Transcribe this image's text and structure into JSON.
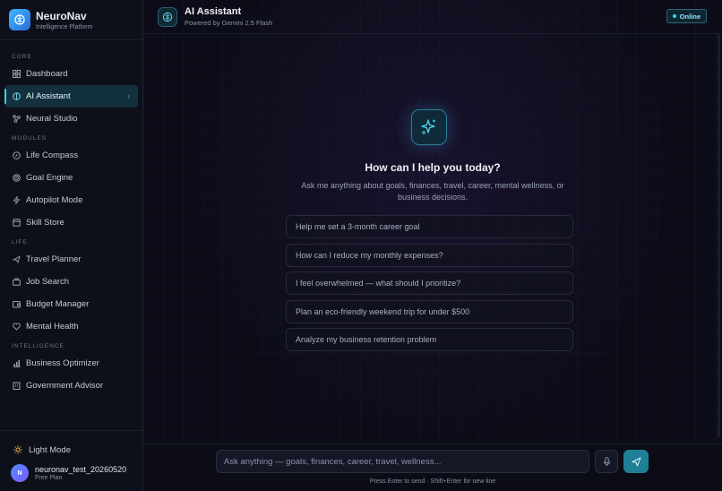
{
  "brand": {
    "name": "NeuroNav",
    "subtitle": "Intelligence Platform"
  },
  "sidebar": {
    "sections": {
      "core": "CORE",
      "modules": "MODULES",
      "life": "LIFE",
      "intelligence": "INTELLIGENCE"
    },
    "items": {
      "dashboard": "Dashboard",
      "ai_assistant": "AI Assistant",
      "neural_studio": "Neural Studio",
      "life_compass": "Life Compass",
      "goal_engine": "Goal Engine",
      "autopilot_mode": "Autopilot Mode",
      "skill_store": "Skill Store",
      "travel_planner": "Travel Planner",
      "job_search": "Job Search",
      "budget_manager": "Budget Manager",
      "mental_health": "Mental Health",
      "business_optimizer": "Business Optimizer",
      "government_advisor": "Government Advisor"
    },
    "active_item": "ai_assistant",
    "light_mode_label": "Light Mode",
    "user": {
      "initial": "N",
      "name": "neuronav_test_20260520",
      "plan": "Free Plan"
    }
  },
  "header": {
    "title": "AI Assistant",
    "subtitle": "Powered by Gemini 2.5 Flash",
    "status": "Online"
  },
  "welcome": {
    "title": "How can I help you today?",
    "description": "Ask me anything about goals, finances, travel, career, mental wellness, or business decisions."
  },
  "suggestions": [
    "Help me set a 3-month career goal",
    "How can I reduce my monthly expenses?",
    "I feel overwhelmed — what should I prioritize?",
    "Plan an eco-friendly weekend trip for under $500",
    "Analyze my business retention problem"
  ],
  "composer": {
    "placeholder": "Ask anything — goals, finances, career, travel, wellness...",
    "hint": "Press Enter to send · Shift+Enter for new line"
  },
  "colors": {
    "accent": "#3ecfe8",
    "background": "#0c0c18",
    "sidebar": "#0e1019"
  }
}
